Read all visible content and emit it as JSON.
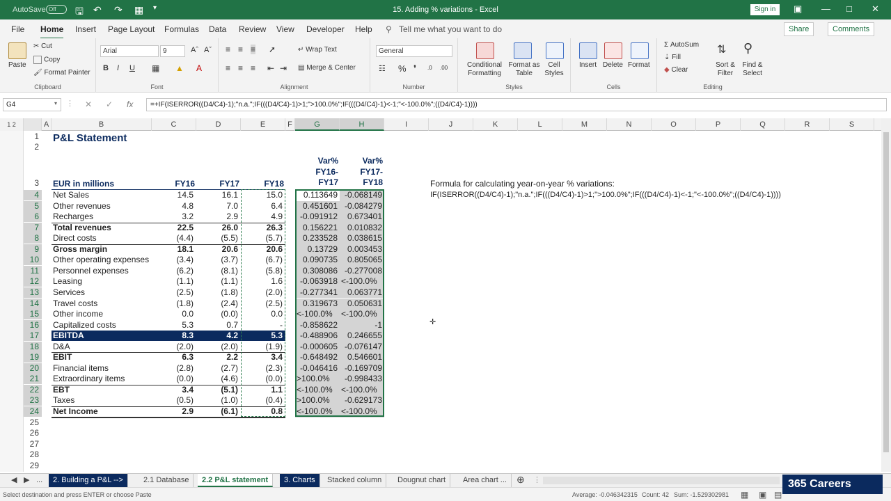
{
  "titlebar": {
    "autosave": "AutoSave",
    "autosave_state": "Off",
    "title": "15. Adding % variations  -  Excel",
    "signin": "Sign in"
  },
  "ribbon_tabs": [
    "File",
    "Home",
    "Insert",
    "Page Layout",
    "Formulas",
    "Data",
    "Review",
    "View",
    "Developer",
    "Help"
  ],
  "tell_me": "Tell me what you want to do",
  "share": "Share",
  "comments": "Comments",
  "clipboard": {
    "paste": "Paste",
    "cut": "Cut",
    "copy": "Copy",
    "format_painter": "Format Painter",
    "label": "Clipboard"
  },
  "font": {
    "name": "Arial",
    "size": "9",
    "label": "Font"
  },
  "alignment": {
    "wrap": "Wrap Text",
    "merge": "Merge & Center",
    "label": "Alignment"
  },
  "number": {
    "format": "General",
    "label": "Number"
  },
  "styles": {
    "cond": "Conditional Formatting",
    "table": "Format as Table",
    "cell": "Cell Styles",
    "label": "Styles"
  },
  "cells": {
    "insert": "Insert",
    "delete": "Delete",
    "format": "Format",
    "label": "Cells"
  },
  "editing": {
    "autosum": "AutoSum",
    "fill": "Fill",
    "clear": "Clear",
    "sort": "Sort & Filter",
    "find": "Find & Select",
    "label": "Editing"
  },
  "formula_bar": {
    "name_box": "G4",
    "formula": "=+IF(ISERROR((D4/C4)-1);\"n.a.\";IF(((D4/C4)-1)>1;\">100.0%\";IF(((D4/C4)-1)<-1;\"<-100.0%\";((D4/C4)-1))))"
  },
  "columns": [
    "A",
    "B",
    "C",
    "D",
    "E",
    "F",
    "G",
    "H",
    "I",
    "J",
    "K",
    "L",
    "M",
    "N",
    "O",
    "P",
    "Q",
    "R",
    "S"
  ],
  "sheet": {
    "title": "P&L Statement",
    "header_label": "EUR in millions",
    "fy16": "FY16",
    "fy17": "FY17",
    "fy18": "FY18",
    "var1": [
      "Var%",
      "FY16-",
      "FY17"
    ],
    "var2": [
      "Var%",
      "FY17-",
      "FY18"
    ],
    "note1": "Formula for calculating year-on-year % variations:",
    "note2": "IF(ISERROR((D4/C4)-1);\"n.a.\";IF(((D4/C4)-1)>1;\">100.0%\";IF(((D4/C4)-1)<-1;\"<-100.0%\";((D4/C4)-1))))",
    "rows": [
      {
        "n": "4",
        "label": "Net Sales",
        "c": "14.5",
        "d": "16.1",
        "e": "15.0",
        "g": "0.113649",
        "h": "-0.068149",
        "bold": false
      },
      {
        "n": "5",
        "label": "Other revenues",
        "c": "4.8",
        "d": "7.0",
        "e": "6.4",
        "g": "0.451601",
        "h": "-0.084279",
        "bold": false
      },
      {
        "n": "6",
        "label": "Recharges",
        "c": "3.2",
        "d": "2.9",
        "e": "4.9",
        "g": "-0.091912",
        "h": "0.673401",
        "bold": false
      },
      {
        "n": "7",
        "label": "Total revenues",
        "c": "22.5",
        "d": "26.0",
        "e": "26.3",
        "g": "0.156221",
        "h": "0.010832",
        "bold": true
      },
      {
        "n": "8",
        "label": "Direct costs",
        "c": "(4.4)",
        "d": "(5.5)",
        "e": "(5.7)",
        "g": "0.233528",
        "h": "0.038615",
        "bold": false
      },
      {
        "n": "9",
        "label": "Gross margin",
        "c": "18.1",
        "d": "20.6",
        "e": "20.6",
        "g": "0.13729",
        "h": "0.003453",
        "bold": true
      },
      {
        "n": "10",
        "label": "Other operating expenses",
        "c": "(3.4)",
        "d": "(3.7)",
        "e": "(6.7)",
        "g": "0.090735",
        "h": "0.805065",
        "bold": false
      },
      {
        "n": "11",
        "label": "Personnel expenses",
        "c": "(6.2)",
        "d": "(8.1)",
        "e": "(5.8)",
        "g": "0.308086",
        "h": "-0.277008",
        "bold": false
      },
      {
        "n": "12",
        "label": "Leasing",
        "c": "(1.1)",
        "d": "(1.1)",
        "e": "1.6",
        "g": "-0.063918",
        "h": "<-100.0%",
        "bold": false
      },
      {
        "n": "13",
        "label": "Services",
        "c": "(2.5)",
        "d": "(1.8)",
        "e": "(2.0)",
        "g": "-0.277341",
        "h": "0.063771",
        "bold": false
      },
      {
        "n": "14",
        "label": "Travel costs",
        "c": "(1.8)",
        "d": "(2.4)",
        "e": "(2.5)",
        "g": "0.319673",
        "h": "0.050631",
        "bold": false
      },
      {
        "n": "15",
        "label": "Other income",
        "c": "0.0",
        "d": "(0.0)",
        "e": "0.0",
        "g": "<-100.0%",
        "h": "<-100.0%",
        "bold": false
      },
      {
        "n": "16",
        "label": "Capitalized costs",
        "c": "5.3",
        "d": "0.7",
        "e": "-",
        "g": "-0.858622",
        "h": "-1",
        "bold": false
      },
      {
        "n": "17",
        "label": "EBITDA",
        "c": "8.3",
        "d": "4.2",
        "e": "5.3",
        "g": "-0.488906",
        "h": "0.246655",
        "bold": true,
        "highlight": true
      },
      {
        "n": "18",
        "label": "D&A",
        "c": "(2.0)",
        "d": "(2.0)",
        "e": "(1.9)",
        "g": "-0.000605",
        "h": "-0.076147",
        "bold": false
      },
      {
        "n": "19",
        "label": "EBIT",
        "c": "6.3",
        "d": "2.2",
        "e": "3.4",
        "g": "-0.648492",
        "h": "0.546601",
        "bold": true
      },
      {
        "n": "20",
        "label": "Financial items",
        "c": "(2.8)",
        "d": "(2.7)",
        "e": "(2.3)",
        "g": "-0.046416",
        "h": "-0.169709",
        "bold": false
      },
      {
        "n": "21",
        "label": "Extraordinary items",
        "c": "(0.0)",
        "d": "(4.6)",
        "e": "(0.0)",
        "g": ">100.0%",
        "h": "-0.998433",
        "bold": false
      },
      {
        "n": "22",
        "label": "EBT",
        "c": "3.4",
        "d": "(5.1)",
        "e": "1.1",
        "g": "<-100.0%",
        "h": "<-100.0%",
        "bold": true
      },
      {
        "n": "23",
        "label": "Taxes",
        "c": "(0.5)",
        "d": "(1.0)",
        "e": "(0.4)",
        "g": ">100.0%",
        "h": "-0.629173",
        "bold": false
      },
      {
        "n": "24",
        "label": "Net Income",
        "c": "2.9",
        "d": "(6.1)",
        "e": "0.8",
        "g": "<-100.0%",
        "h": "<-100.0%",
        "bold": true
      }
    ]
  },
  "sheet_tabs": [
    "2. Building a P&L -->",
    "2.1 Database",
    "2.2 P&L statement",
    "3. Charts",
    "Stacked column",
    "Dougnut chart",
    "Area chart ..."
  ],
  "status": {
    "message": "Select destination and press ENTER or choose Paste",
    "average": "Average: -0.046342315",
    "count": "Count: 42",
    "sum": "Sum: -1.529302981"
  },
  "logo": "365 Careers"
}
